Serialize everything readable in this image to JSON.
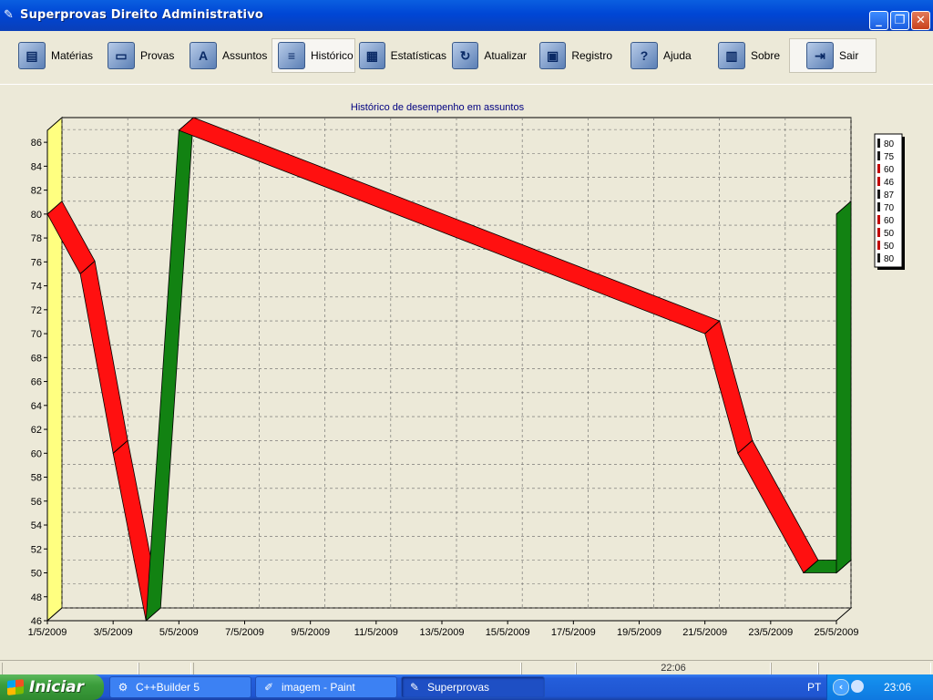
{
  "window": {
    "title": "Superprovas Direito Administrativo",
    "icon": "pen-icon",
    "controls": [
      "minimize",
      "maximize",
      "close"
    ]
  },
  "toolbar": {
    "buttons": [
      {
        "label": "Matérias",
        "icon": "book-icon"
      },
      {
        "label": "Provas",
        "icon": "folder-icon"
      },
      {
        "label": "Assuntos",
        "icon": "letter-a-icon"
      },
      {
        "label": "Histórico",
        "icon": "history-icon",
        "active": true
      },
      {
        "label": "Estatísticas",
        "icon": "stats-icon"
      },
      {
        "label": "Atualizar",
        "icon": "refresh-icon"
      },
      {
        "label": "Registro",
        "icon": "register-icon"
      },
      {
        "label": "Ajuda",
        "icon": "help-icon"
      },
      {
        "label": "Sobre",
        "icon": "film-icon"
      },
      {
        "label": "Sair",
        "icon": "exit-door-icon"
      }
    ]
  },
  "chart_data": {
    "type": "line",
    "style": "3d-ribbon",
    "title": "Histórico de desempenho em assuntos",
    "xlabel": "",
    "ylabel": "",
    "x_axis": "date",
    "x_ticks": [
      "1/5/2009",
      "3/5/2009",
      "5/5/2009",
      "7/5/2009",
      "9/5/2009",
      "11/5/2009",
      "13/5/2009",
      "15/5/2009",
      "17/5/2009",
      "19/5/2009",
      "21/5/2009",
      "23/5/2009",
      "25/5/2009"
    ],
    "y_ticks": [
      46,
      48,
      50,
      52,
      54,
      56,
      58,
      60,
      62,
      64,
      66,
      68,
      70,
      72,
      74,
      76,
      78,
      80,
      82,
      84,
      86
    ],
    "ylim": [
      46,
      87
    ],
    "grid": true,
    "points": [
      {
        "x": "1/5/2009",
        "y": 80
      },
      {
        "x": "2/5/2009",
        "y": 75
      },
      {
        "x": "3/5/2009",
        "y": 60
      },
      {
        "x": "4/5/2009",
        "y": 46
      },
      {
        "x": "5/5/2009",
        "y": 87
      },
      {
        "x": "21/5/2009",
        "y": 70
      },
      {
        "x": "22/5/2009",
        "y": 60
      },
      {
        "x": "24/5/2009",
        "y": 50
      },
      {
        "x": "25/5/2009",
        "y": 50
      },
      {
        "x": "25/5/2009",
        "y": 80
      }
    ],
    "legend": {
      "placement": "right",
      "entries": [
        "80",
        "75",
        "60",
        "46",
        "87",
        "70",
        "60",
        "50",
        "50",
        "80"
      ],
      "colors": [
        "#1a1a1a",
        "#1a1a1a",
        "#c00000",
        "#c00000",
        "#1a1a1a",
        "#1a1a1a",
        "#c00000",
        "#c00000",
        "#c00000",
        "#1a1a1a"
      ]
    },
    "colors": {
      "up": "#128212",
      "up_dark": "#0f5a0f",
      "down": "#ff1010",
      "left_wall": "#ffff80",
      "back_wall": "#ECE9D8"
    }
  },
  "statusbar": {
    "cells": [
      "",
      "",
      "",
      "",
      "22:06",
      "",
      ""
    ]
  },
  "taskbar": {
    "start_label": "Iniciar",
    "tasks": [
      {
        "label": "C++Builder 5",
        "icon": "cbuilder-icon"
      },
      {
        "label": "imagem - Paint",
        "icon": "paint-icon"
      },
      {
        "label": "Superprovas",
        "icon": "pen-icon",
        "active": true
      }
    ],
    "language": "PT",
    "clock": "23:06"
  }
}
